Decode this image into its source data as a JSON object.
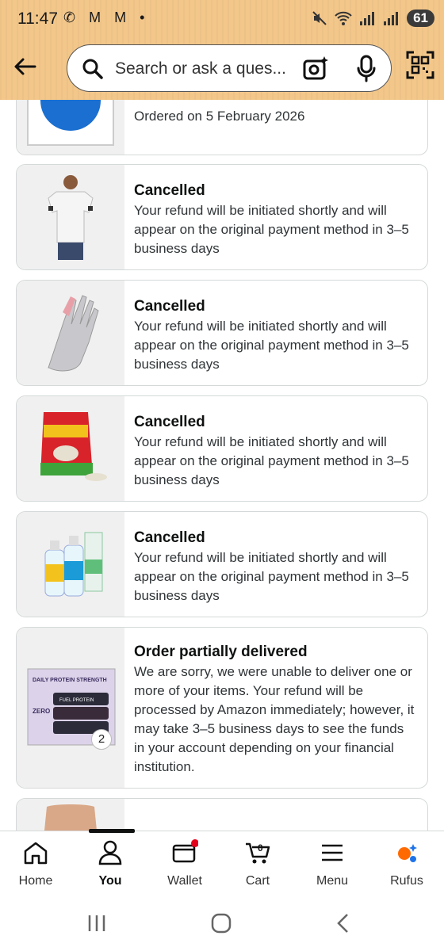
{
  "status_bar": {
    "time": "11:47",
    "notif_icons": "✆ M M •",
    "battery": "61"
  },
  "search": {
    "placeholder": "Search or ask a ques..."
  },
  "orders": [
    {
      "status": "",
      "message": "Ordered on 5 February 2026",
      "image": "bank-logo"
    },
    {
      "status": "Cancelled",
      "message": "Your refund will be initiated shortly and will appear on the original payment method in 3–5 business days",
      "image": "polo-tshirt"
    },
    {
      "status": "Cancelled",
      "message": "Your refund will be initiated shortly and will appear on the original payment method in 3–5 business days",
      "image": "gloves"
    },
    {
      "status": "Cancelled",
      "message": "Your refund will be initiated shortly and will appear on the original payment method in 3–5 business days",
      "image": "protein-powder"
    },
    {
      "status": "Cancelled",
      "message": "Your refund will be initiated shortly and will appear on the original payment method in 3–5 business days",
      "image": "spray-bottles"
    },
    {
      "status": "Order partially delivered",
      "message": "We are sorry, we were unable to deliver one or more of your items. Your refund will be processed by Amazon immediately; however, it may take 3–5 business days to see the funds in your account depending on your financial institution.",
      "image": "protein-bars",
      "item_count": "2",
      "product_text": {
        "line1": "DAILY PROTEIN STRENGTH",
        "line2": "ZERO",
        "line3": "FUEL PROTEIN"
      }
    },
    {
      "status": "",
      "message": "",
      "image": "partial-item"
    }
  ],
  "nav": {
    "items": [
      {
        "label": "Home",
        "icon": "home-icon"
      },
      {
        "label": "You",
        "icon": "person-icon",
        "active": true
      },
      {
        "label": "Wallet",
        "icon": "wallet-icon",
        "notification_dot": true
      },
      {
        "label": "Cart",
        "icon": "cart-icon",
        "count": "0"
      },
      {
        "label": "Menu",
        "icon": "menu-icon"
      },
      {
        "label": "Rufus",
        "icon": "rufus-icon"
      }
    ]
  },
  "colors": {
    "header_bg": "#f3c78a",
    "dot": "#e3001b",
    "rufus_orange": "#ff6a00",
    "rufus_blue": "#1f73e8"
  }
}
